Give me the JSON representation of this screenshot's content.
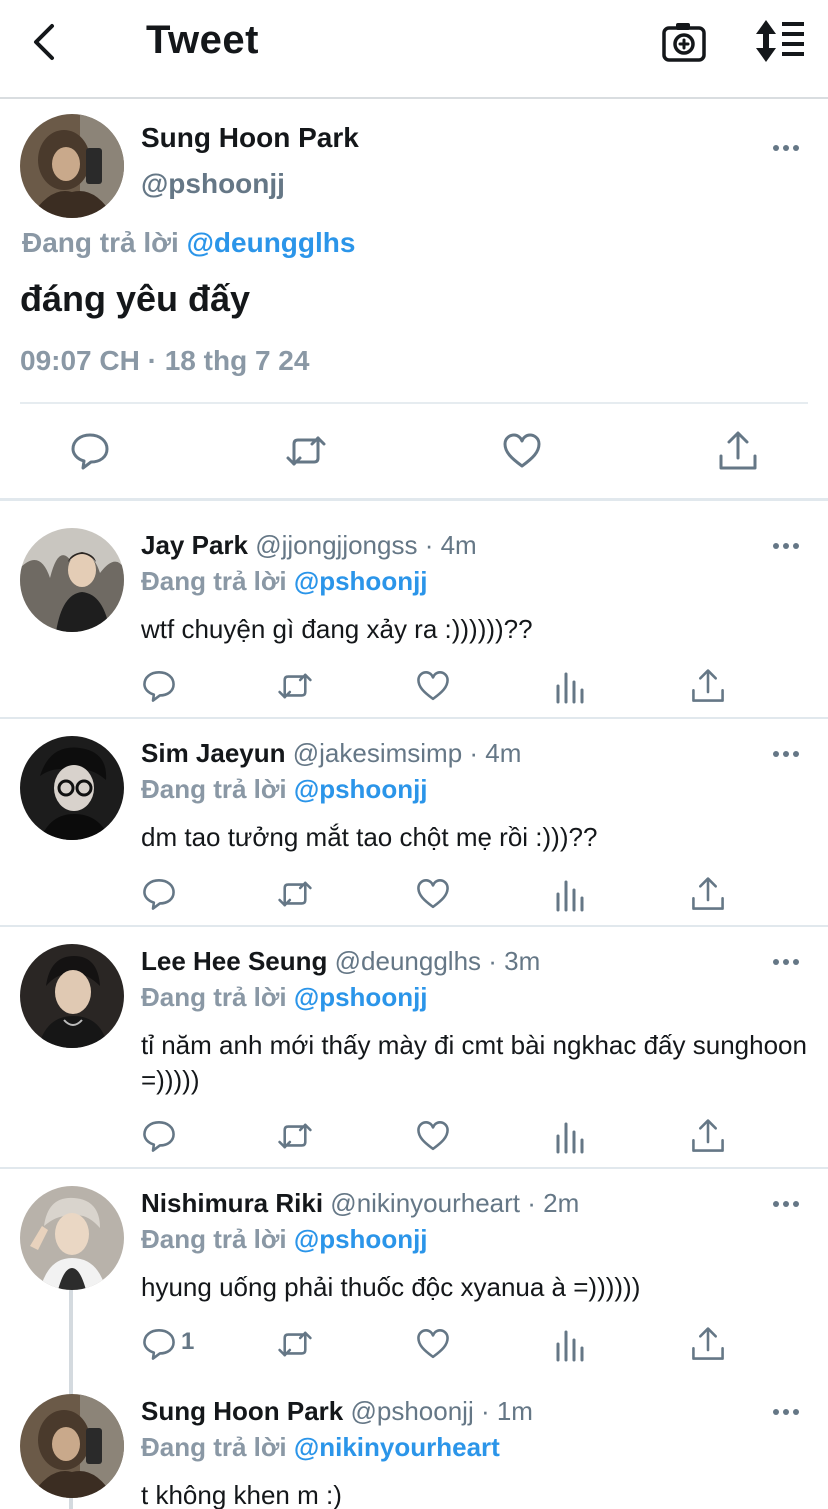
{
  "header": {
    "title": "Tweet",
    "back_icon": "chevron-left-icon",
    "camera_icon": "camera-add-icon",
    "sort_icon": "sort-lines-icon"
  },
  "main_tweet": {
    "name": "Sung Hoon Park",
    "handle": "@pshoonjj",
    "replying_prefix": "Đang trả lời",
    "replying_to": "@deungglhs",
    "text": "đáng yêu đấy",
    "timestamp": "09:07 CH · 18 thg 7 24"
  },
  "replies": [
    {
      "name": "Jay Park",
      "handle": "@jjongjjongss",
      "time": "· 4m",
      "replying_prefix": "Đang trả lời",
      "replying_to": "@pshoonjj",
      "text": "wtf chuyện gì đang xảy ra :))))))??",
      "reply_count": ""
    },
    {
      "name": "Sim Jaeyun",
      "handle": "@jakesimsimp",
      "time": "· 4m",
      "replying_prefix": "Đang trả lời",
      "replying_to": "@pshoonjj",
      "text": "dm tao tưởng mắt tao chột mẹ rồi :)))??",
      "reply_count": ""
    },
    {
      "name": "Lee Hee Seung",
      "handle": "@deungglhs",
      "time": "· 3m",
      "replying_prefix": "Đang trả lời",
      "replying_to": "@pshoonjj",
      "text": "tỉ năm anh mới thấy mày đi cmt bài ngkhac đấy sunghoon =)))))",
      "reply_count": ""
    },
    {
      "name": "Nishimura Riki",
      "handle": "@nikinyourheart",
      "time": "· 2m",
      "replying_prefix": "Đang trả lời",
      "replying_to": "@pshoonjj",
      "text": "hyung uống phải thuốc độc xyanua à =))))))",
      "reply_count": "1"
    },
    {
      "name": "Sung Hoon Park",
      "handle": "@pshoonjj",
      "time": "· 1m",
      "replying_prefix": "Đang trả lời",
      "replying_to": "@nikinyourheart",
      "text": "t không khen m :)",
      "reply_count": ""
    }
  ],
  "colors": {
    "mention": "#2b95e9",
    "meta": "#657786",
    "icon": "#657786",
    "divider": "#e1e8ed"
  }
}
